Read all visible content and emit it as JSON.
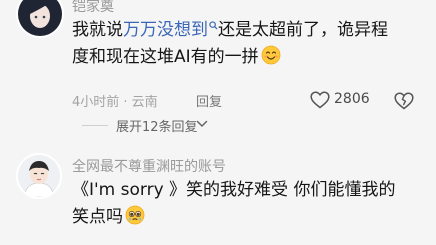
{
  "comments": [
    {
      "username": "铠家奠",
      "text_before": "我就说",
      "highlight": "万万没想到",
      "text_after": "还是太超前了，诡异程度和现在这堆AI有的一拼",
      "emoji": "smiling-face",
      "time": "4小时前 · 云南",
      "reply_label": "回复",
      "likes": "2806"
    },
    {
      "username": "全网最不尊重渊旺的账号",
      "text": "《I'm sorry 》笑的我好难受 你们能懂我的笑点吗",
      "emoji": "pleading-face"
    }
  ],
  "expand_label": "展开12条回复",
  "colors": {
    "background": "#f5f5f5",
    "primary_text": "#161616",
    "secondary_text": "#9a9a9a",
    "link_highlight": "#3a66b8"
  }
}
